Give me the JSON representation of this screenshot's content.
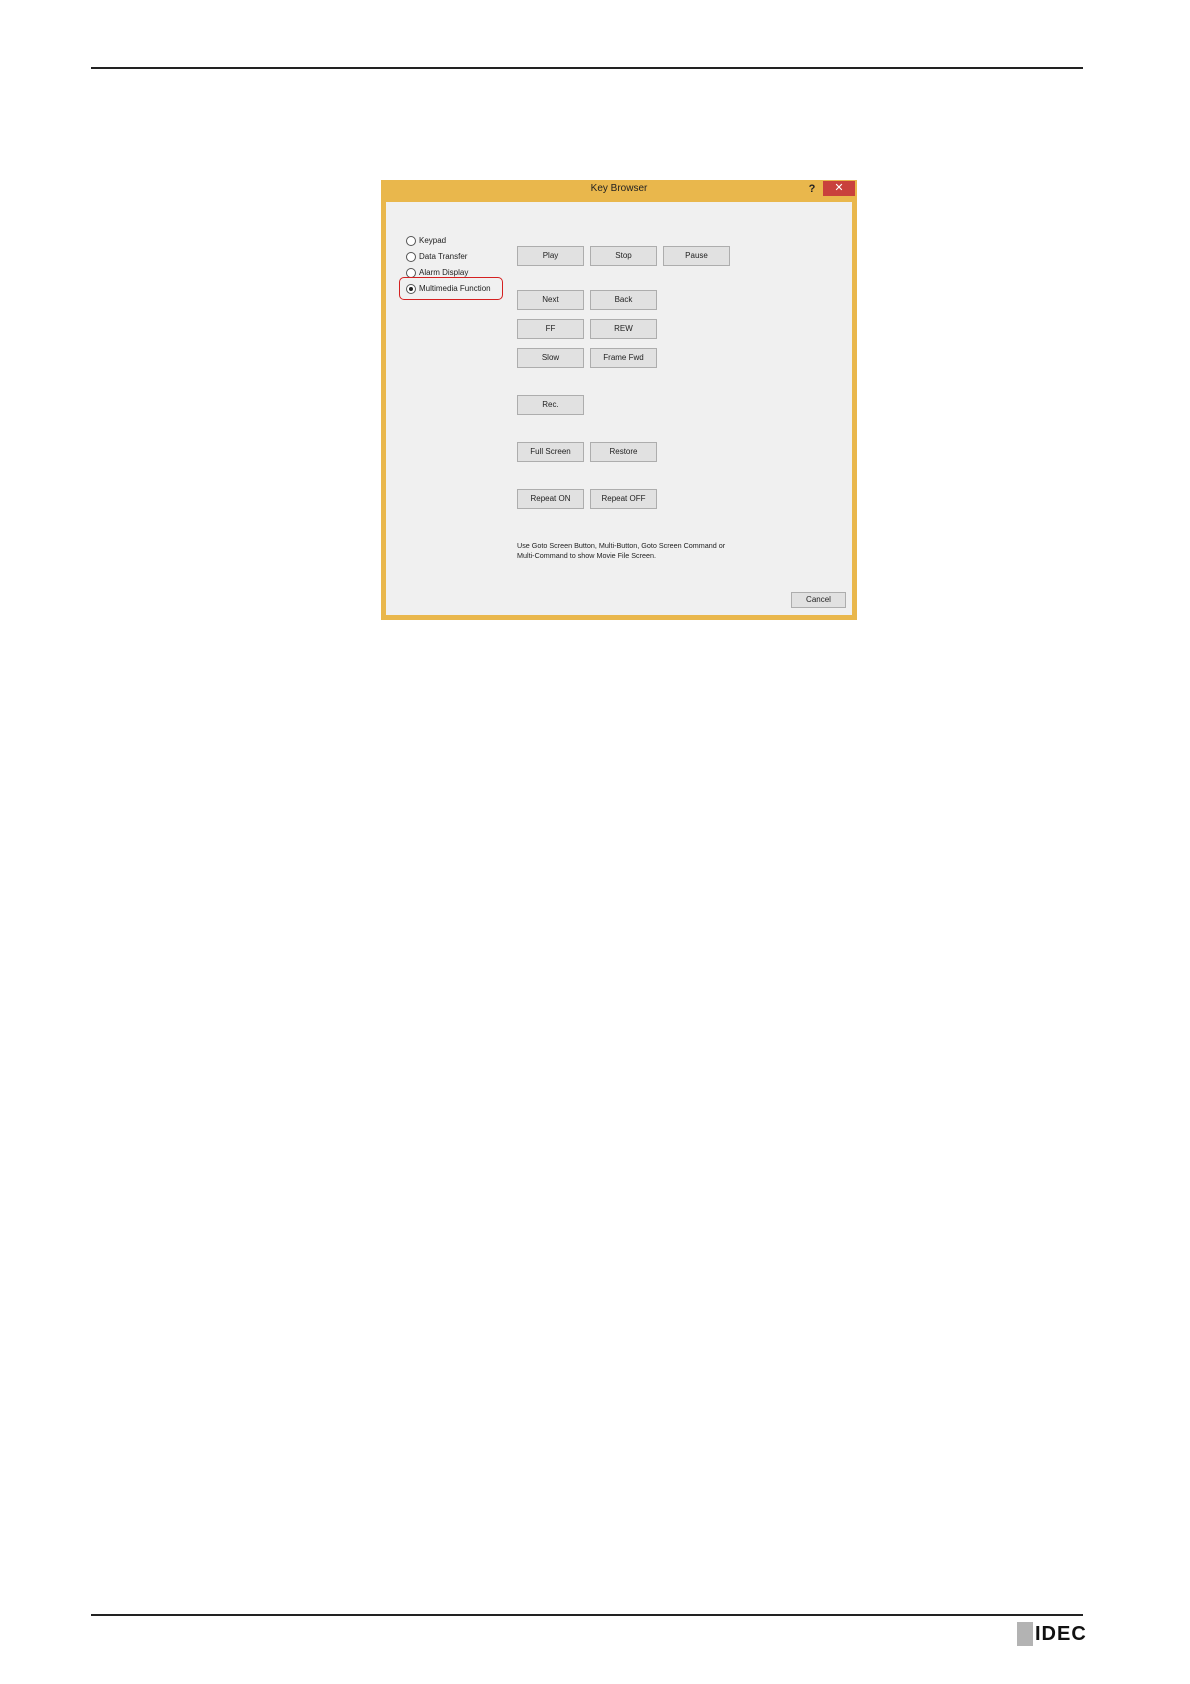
{
  "dialog": {
    "title": "Key Browser",
    "help_label": "?",
    "close_label": "✕",
    "radio_options": [
      {
        "label": "Keypad",
        "checked": false
      },
      {
        "label": "Data Transfer",
        "checked": false
      },
      {
        "label": "Alarm Display",
        "checked": false
      },
      {
        "label": "Multimedia Function",
        "checked": true
      }
    ],
    "buttons": {
      "play": "Play",
      "stop": "Stop",
      "pause": "Pause",
      "next": "Next",
      "back": "Back",
      "ff": "FF",
      "rew": "REW",
      "slow": "Slow",
      "frame_fwd": "Frame Fwd",
      "rec": "Rec.",
      "full_screen": "Full Screen",
      "restore": "Restore",
      "repeat_on": "Repeat ON",
      "repeat_off": "Repeat OFF",
      "cancel": "Cancel"
    },
    "note_line1": "Use Goto Screen Button, Multi-Button, Goto Screen Command or",
    "note_line2": "Multi-Command to show Movie File Screen."
  },
  "footer": {
    "logo_text": "IDEC"
  },
  "colors": {
    "title_bar": "#e9b74c",
    "close_button": "#c9413c",
    "highlight": "#d42020"
  }
}
